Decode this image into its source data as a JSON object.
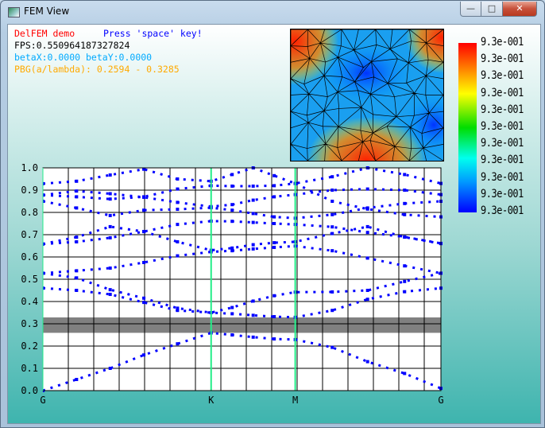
{
  "window": {
    "title": "FEM View",
    "minimize": "—",
    "maximize": "□",
    "close": "✕",
    "icon": "app-icon"
  },
  "overlay": {
    "demo": "DelFEM demo",
    "hint": "Press 'space' key!",
    "fps": "FPS:0.550964187327824",
    "beta": "betaX:0.0000 betaY:0.0000",
    "pbg": "PBG(a/lambda): 0.2594 - 0.3285",
    "colors": {
      "demo": "#ff0000",
      "hint": "#0000ff",
      "fps": "#000000",
      "beta": "#00aaff",
      "pbg": "#ffaa00"
    }
  },
  "colorbar": {
    "labels": [
      "9.3e-001",
      "9.3e-001",
      "9.3e-001",
      "9.3e-001",
      "9.3e-001",
      "9.3e-001",
      "9.3e-001",
      "9.3e-001",
      "9.3e-001",
      "9.3e-001",
      "9.3e-001"
    ],
    "colors": [
      "#ff0000",
      "#ffff00",
      "#00dd00",
      "#00ffee",
      "#0000ff"
    ]
  },
  "chart_data": {
    "type": "scatter",
    "title": "",
    "xlabel": "",
    "ylabel": "",
    "ylim": [
      0,
      1.0
    ],
    "yticks": [
      "0.0",
      "0.1",
      "0.2",
      "0.3",
      "0.4",
      "0.5",
      "0.6",
      "0.7",
      "0.8",
      "0.9",
      "1.0"
    ],
    "xticks": [
      {
        "label": "G",
        "k": 0
      },
      {
        "label": "K",
        "k": 1.0
      },
      {
        "label": "M",
        "k": 1.5
      },
      {
        "label": "G",
        "k": 2.366
      }
    ],
    "grid": true,
    "band_gap": {
      "low": 0.2594,
      "high": 0.3285,
      "color": "#808080"
    },
    "symmetry_line_color": "#22ee88",
    "point_color": "#0000ff",
    "k": [
      0,
      0.2,
      0.4,
      0.6,
      0.8,
      1.0,
      1.125,
      1.25,
      1.375,
      1.5,
      1.72,
      1.93,
      2.15,
      2.366
    ],
    "bands": [
      [
        0.0,
        0.05,
        0.1,
        0.16,
        0.21,
        0.259,
        0.25,
        0.24,
        0.232,
        0.229,
        0.194,
        0.13,
        0.077,
        0.01
      ],
      [
        0.46,
        0.45,
        0.432,
        0.396,
        0.36,
        0.35,
        0.345,
        0.338,
        0.332,
        0.329,
        0.36,
        0.41,
        0.444,
        0.46
      ],
      [
        0.527,
        0.506,
        0.453,
        0.415,
        0.37,
        0.35,
        0.373,
        0.402,
        0.426,
        0.442,
        0.443,
        0.45,
        0.49,
        0.527
      ],
      [
        0.527,
        0.538,
        0.55,
        0.575,
        0.605,
        0.623,
        0.628,
        0.636,
        0.643,
        0.649,
        0.628,
        0.595,
        0.56,
        0.527
      ],
      [
        0.658,
        0.689,
        0.736,
        0.714,
        0.668,
        0.63,
        0.64,
        0.655,
        0.664,
        0.668,
        0.705,
        0.736,
        0.689,
        0.66
      ],
      [
        0.658,
        0.668,
        0.686,
        0.714,
        0.746,
        0.761,
        0.76,
        0.755,
        0.75,
        0.746,
        0.735,
        0.71,
        0.69,
        0.661
      ],
      [
        0.85,
        0.82,
        0.786,
        0.81,
        0.814,
        0.821,
        0.81,
        0.795,
        0.78,
        0.774,
        0.79,
        0.82,
        0.84,
        0.85
      ],
      [
        0.878,
        0.896,
        0.884,
        0.868,
        0.845,
        0.826,
        0.835,
        0.855,
        0.87,
        0.88,
        0.9,
        0.905,
        0.9,
        0.88
      ],
      [
        0.929,
        0.94,
        0.968,
        0.994,
        0.95,
        0.94,
        0.97,
        1.0,
        0.965,
        0.93,
        0.96,
        1.0,
        0.97,
        0.93
      ],
      [
        0.878,
        0.87,
        0.86,
        0.87,
        0.905,
        0.92,
        0.918,
        0.918,
        0.92,
        0.93,
        0.85,
        0.815,
        0.79,
        0.78
      ]
    ]
  }
}
